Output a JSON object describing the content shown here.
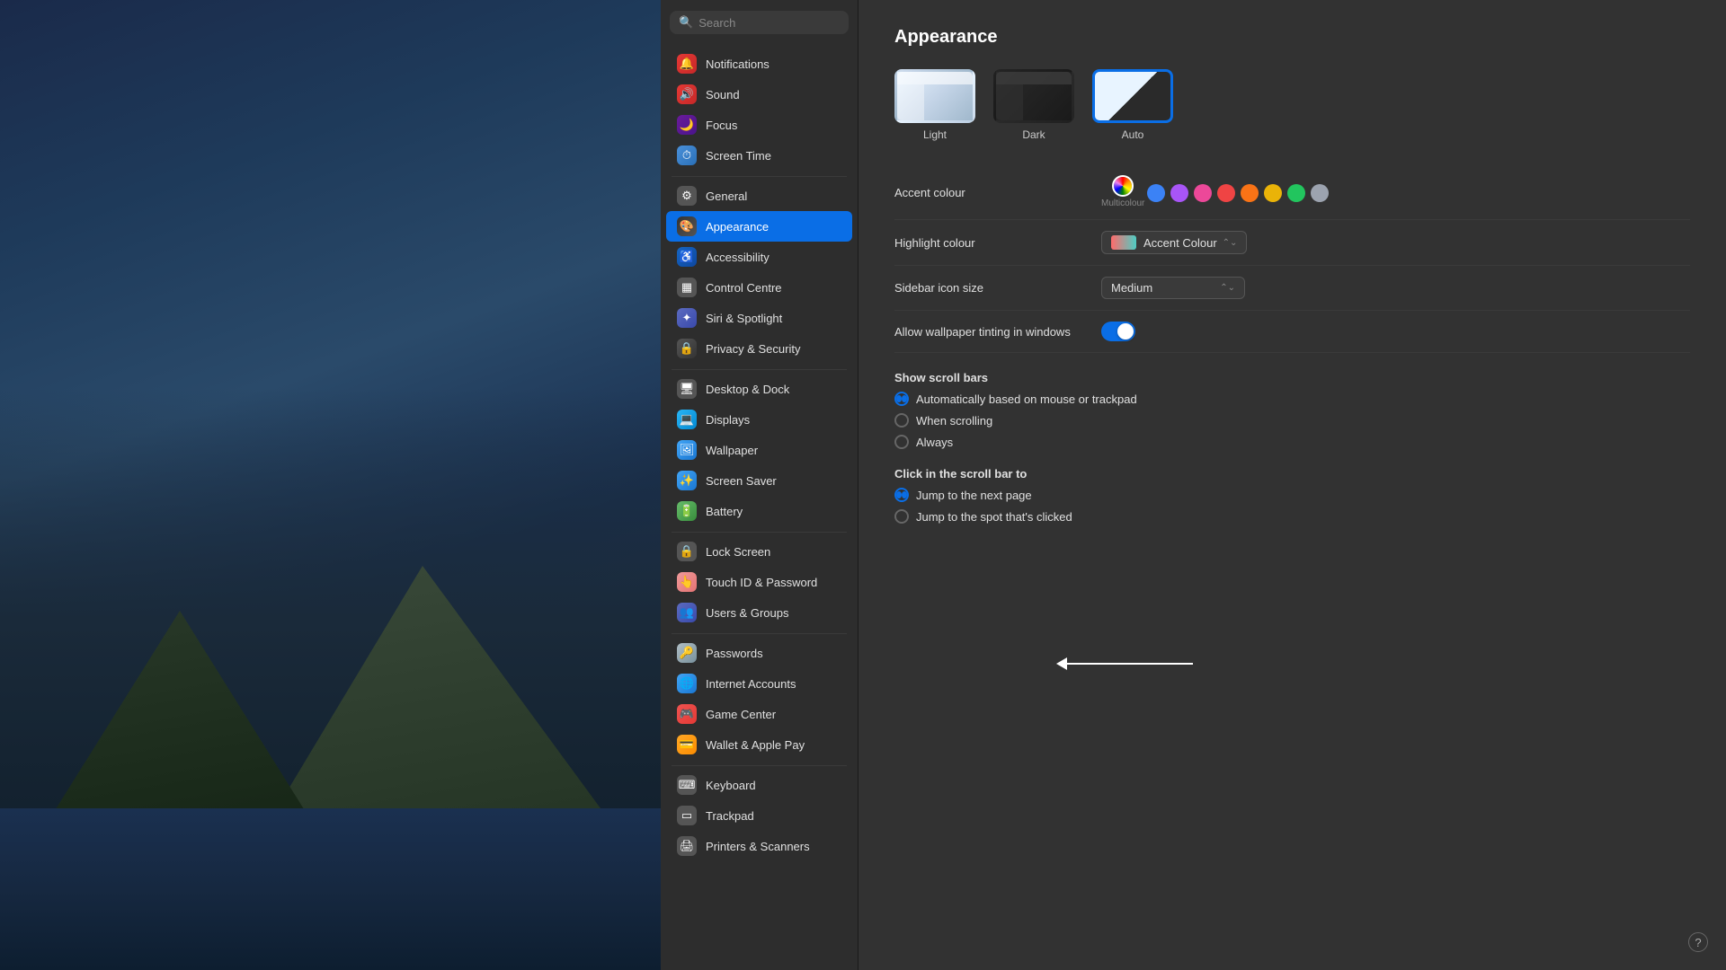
{
  "desktop": {
    "alt": "macOS Catalina coastal wallpaper"
  },
  "sidebar": {
    "search": {
      "placeholder": "Search",
      "value": ""
    },
    "sections": [
      {
        "id": "top",
        "items": [
          {
            "id": "notifications",
            "label": "Notifications",
            "icon": "🔔",
            "iconClass": "icon-notifications"
          },
          {
            "id": "sound",
            "label": "Sound",
            "icon": "🔊",
            "iconClass": "icon-sound"
          },
          {
            "id": "focus",
            "label": "Focus",
            "icon": "🌙",
            "iconClass": "icon-focus"
          },
          {
            "id": "screentime",
            "label": "Screen Time",
            "icon": "⏱",
            "iconClass": "icon-screentime"
          }
        ]
      },
      {
        "id": "mid1",
        "items": [
          {
            "id": "general",
            "label": "General",
            "icon": "⚙",
            "iconClass": "icon-general"
          },
          {
            "id": "appearance",
            "label": "Appearance",
            "icon": "🎨",
            "iconClass": "icon-appearance",
            "active": true
          },
          {
            "id": "accessibility",
            "label": "Accessibility",
            "icon": "♿",
            "iconClass": "icon-accessibility"
          },
          {
            "id": "controlcentre",
            "label": "Control Centre",
            "icon": "▦",
            "iconClass": "icon-controlcentre"
          },
          {
            "id": "siri",
            "label": "Siri & Spotlight",
            "icon": "✦",
            "iconClass": "icon-siri"
          },
          {
            "id": "privacy",
            "label": "Privacy & Security",
            "icon": "🔒",
            "iconClass": "icon-privacy"
          }
        ]
      },
      {
        "id": "mid2",
        "items": [
          {
            "id": "desktop",
            "label": "Desktop & Dock",
            "icon": "🖥",
            "iconClass": "icon-desktop"
          },
          {
            "id": "displays",
            "label": "Displays",
            "icon": "💻",
            "iconClass": "icon-displays"
          },
          {
            "id": "wallpaper",
            "label": "Wallpaper",
            "icon": "🖼",
            "iconClass": "icon-wallpaper"
          },
          {
            "id": "screensaver",
            "label": "Screen Saver",
            "icon": "✨",
            "iconClass": "icon-screensaver"
          },
          {
            "id": "battery",
            "label": "Battery",
            "icon": "🔋",
            "iconClass": "icon-battery"
          }
        ]
      },
      {
        "id": "mid3",
        "items": [
          {
            "id": "lockscreen",
            "label": "Lock Screen",
            "icon": "🔒",
            "iconClass": "icon-lockscreen"
          },
          {
            "id": "touchid",
            "label": "Touch ID & Password",
            "icon": "👆",
            "iconClass": "icon-touchid"
          },
          {
            "id": "users",
            "label": "Users & Groups",
            "icon": "👥",
            "iconClass": "icon-users"
          }
        ]
      },
      {
        "id": "bot",
        "items": [
          {
            "id": "passwords",
            "label": "Passwords",
            "icon": "🔑",
            "iconClass": "icon-passwords"
          },
          {
            "id": "internet",
            "label": "Internet Accounts",
            "icon": "🌐",
            "iconClass": "icon-internet"
          },
          {
            "id": "gamecenter",
            "label": "Game Center",
            "icon": "🎮",
            "iconClass": "icon-gamecenter"
          },
          {
            "id": "wallet",
            "label": "Wallet & Apple Pay",
            "icon": "💳",
            "iconClass": "icon-wallet"
          }
        ]
      },
      {
        "id": "bot2",
        "items": [
          {
            "id": "keyboard",
            "label": "Keyboard",
            "icon": "⌨",
            "iconClass": "icon-keyboard"
          },
          {
            "id": "trackpad",
            "label": "Trackpad",
            "icon": "▭",
            "iconClass": "icon-trackpad"
          },
          {
            "id": "printers",
            "label": "Printers & Scanners",
            "icon": "🖨",
            "iconClass": "icon-printers"
          }
        ]
      }
    ]
  },
  "main": {
    "title": "Appearance",
    "modes": [
      {
        "id": "light",
        "label": "Light",
        "selected": false
      },
      {
        "id": "dark",
        "label": "Dark",
        "selected": false
      },
      {
        "id": "auto",
        "label": "Auto",
        "selected": true
      }
    ],
    "accentColour": {
      "label": "Accent colour",
      "colors": [
        {
          "id": "multicolor",
          "color": "conic-gradient(red, orange, yellow, green, blue, violet, red)",
          "label": "Multicolour",
          "selected": true,
          "isMulti": true
        },
        {
          "id": "blue",
          "color": "#3b82f6",
          "label": ""
        },
        {
          "id": "purple",
          "color": "#a855f7",
          "label": ""
        },
        {
          "id": "pink",
          "color": "#ec4899",
          "label": ""
        },
        {
          "id": "red",
          "color": "#ef4444",
          "label": ""
        },
        {
          "id": "orange",
          "color": "#f97316",
          "label": ""
        },
        {
          "id": "yellow",
          "color": "#eab308",
          "label": ""
        },
        {
          "id": "green",
          "color": "#22c55e",
          "label": ""
        },
        {
          "id": "graphite",
          "color": "#9ca3af",
          "label": ""
        }
      ],
      "selectedLabel": "Multicolour"
    },
    "highlightColour": {
      "label": "Highlight colour",
      "value": "Accent Colour"
    },
    "sidebarIconSize": {
      "label": "Sidebar icon size",
      "value": "Medium"
    },
    "wallpaperTinting": {
      "label": "Allow wallpaper tinting in windows",
      "enabled": true
    },
    "showScrollBars": {
      "label": "Show scroll bars",
      "options": [
        {
          "id": "auto",
          "label": "Automatically based on mouse or trackpad",
          "checked": true
        },
        {
          "id": "scrolling",
          "label": "When scrolling",
          "checked": false
        },
        {
          "id": "always",
          "label": "Always",
          "checked": false
        }
      ]
    },
    "clickScrollBar": {
      "label": "Click in the scroll bar to",
      "options": [
        {
          "id": "nextpage",
          "label": "Jump to the next page",
          "checked": true
        },
        {
          "id": "clickedspot",
          "label": "Jump to the spot that's clicked",
          "checked": false
        }
      ]
    }
  },
  "arrow": {
    "label": "keyboard arrow annotation"
  }
}
